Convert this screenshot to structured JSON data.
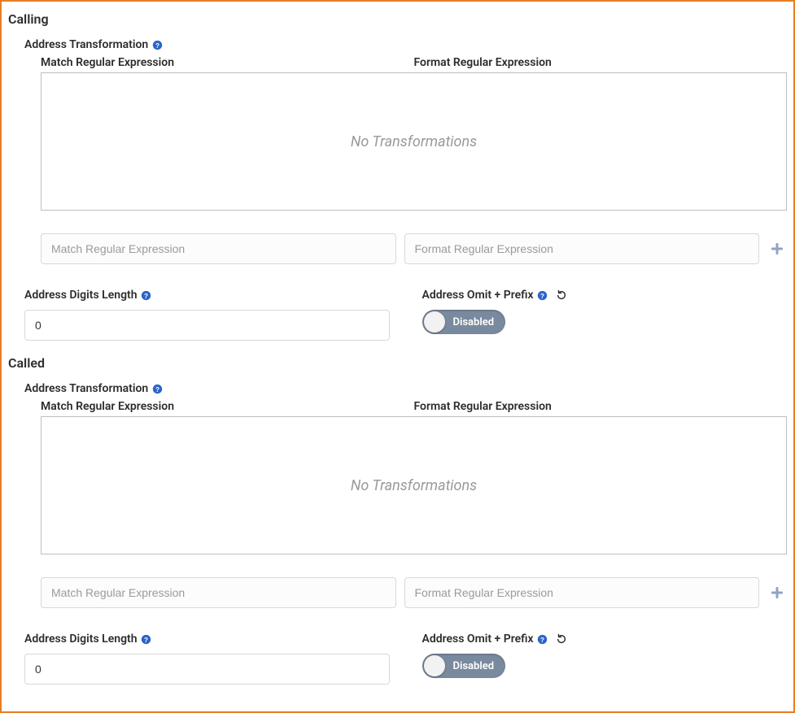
{
  "calling": {
    "title": "Calling",
    "address_transformation_label": "Address Transformation",
    "match_header": "Match Regular Expression",
    "format_header": "Format Regular Expression",
    "no_transformations_text": "No Transformations",
    "match_placeholder": "Match Regular Expression",
    "format_placeholder": "Format Regular Expression",
    "digits_length_label": "Address Digits Length",
    "digits_length_value": "0",
    "omit_prefix_label": "Address Omit + Prefix",
    "toggle_label": "Disabled"
  },
  "called": {
    "title": "Called",
    "address_transformation_label": "Address Transformation",
    "match_header": "Match Regular Expression",
    "format_header": "Format Regular Expression",
    "no_transformations_text": "No Transformations",
    "match_placeholder": "Match Regular Expression",
    "format_placeholder": "Format Regular Expression",
    "digits_length_label": "Address Digits Length",
    "digits_length_value": "0",
    "omit_prefix_label": "Address Omit + Prefix",
    "toggle_label": "Disabled"
  }
}
